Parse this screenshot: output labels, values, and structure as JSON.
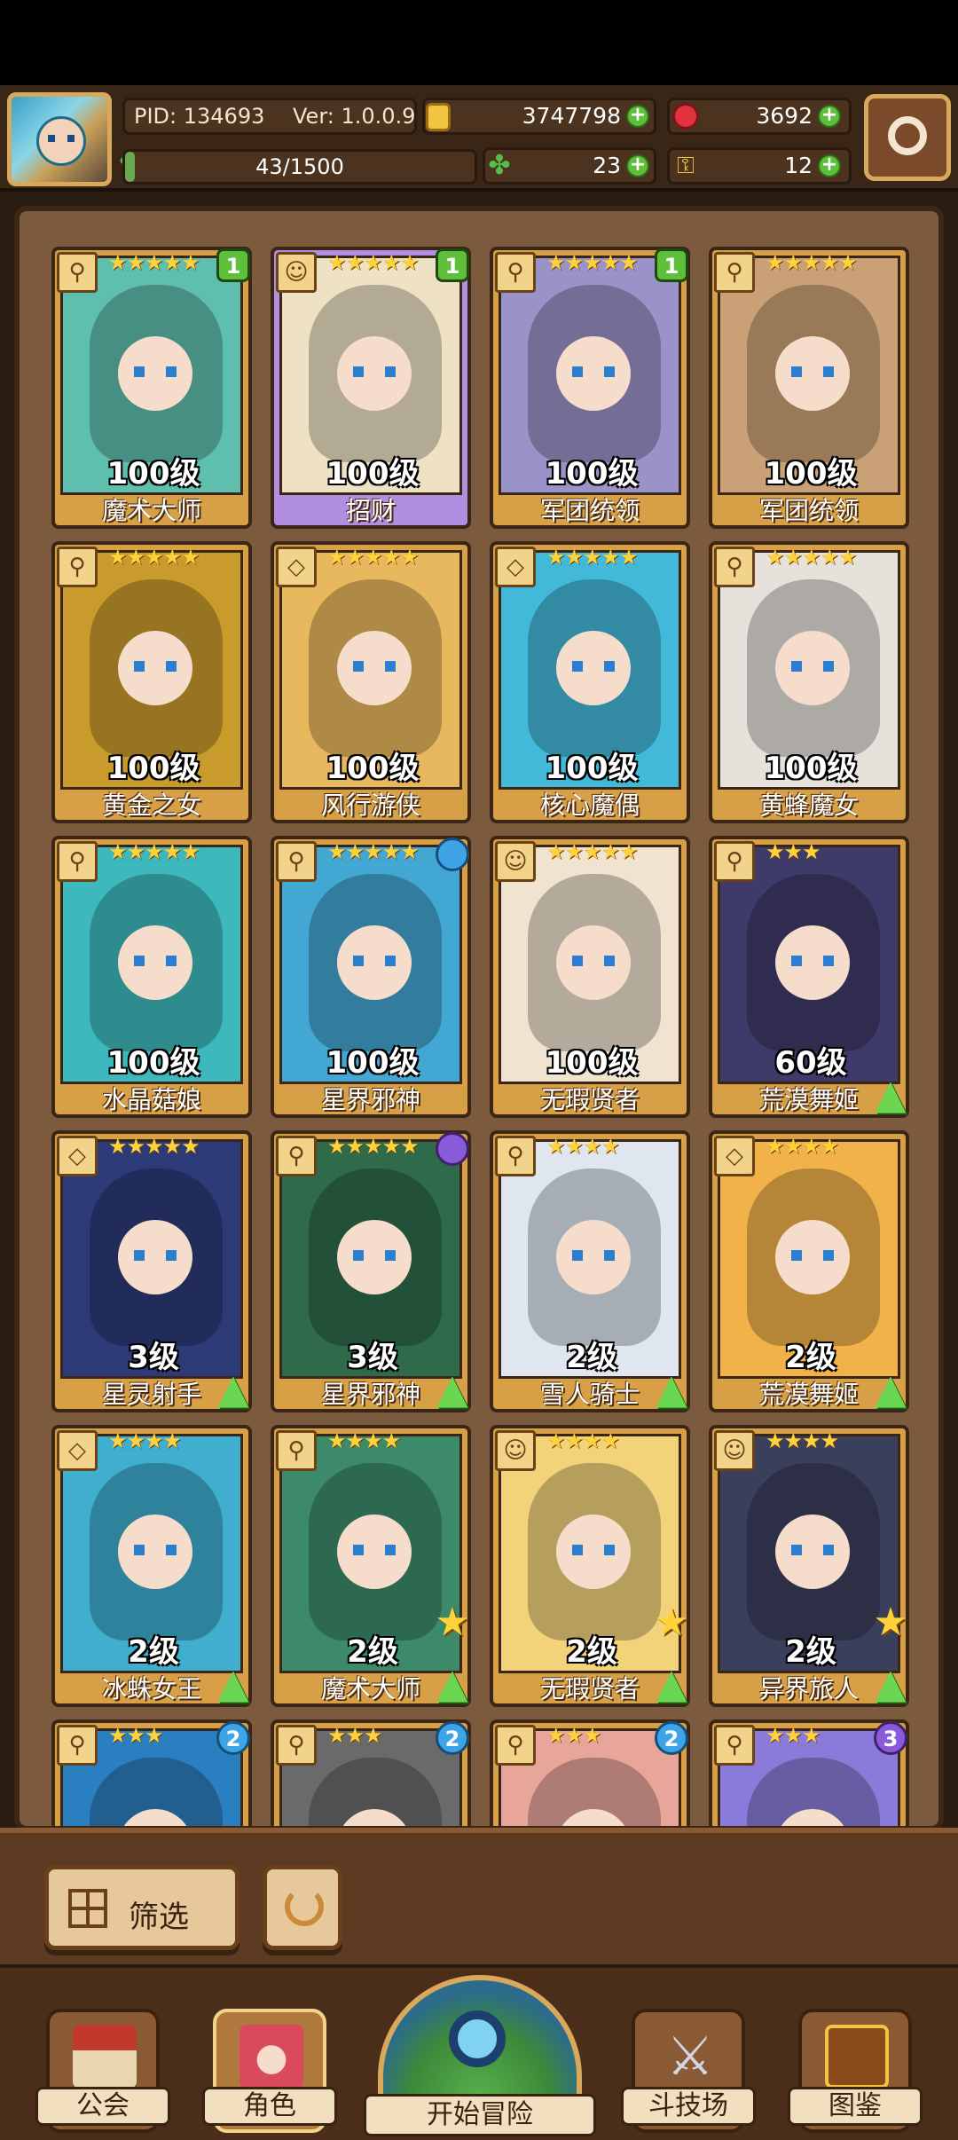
{
  "header": {
    "pid": "PID: 134693",
    "version": "Ver: 1.0.0.9",
    "gold": "3747798",
    "gems": "3692",
    "exp": "43/1500",
    "exp_fraction": 0.029,
    "clover": "23",
    "keys": "12",
    "icons": {
      "avatar": "player-avatar",
      "gold": "gold-coin-icon",
      "gems": "red-gem-icon",
      "clover": "clover-icon",
      "keys": "key-icon",
      "settings": "gear-icon"
    }
  },
  "cards": [
    {
      "level": "100级",
      "name": "魔术大师",
      "stars": "★★★★★",
      "badge": "1",
      "badge_type": "green",
      "frame": "gold",
      "art": "#5fbfae",
      "extra": ""
    },
    {
      "level": "100级",
      "name": "招财",
      "stars": "★★★★★",
      "badge": "1",
      "badge_type": "green",
      "frame": "purple",
      "art": "#efe2c4",
      "extra": ""
    },
    {
      "level": "100级",
      "name": "军团统领",
      "stars": "★★★★★",
      "badge": "1",
      "badge_type": "green",
      "frame": "gold",
      "art": "#9a93c9",
      "extra": ""
    },
    {
      "level": "100级",
      "name": "军团统领",
      "stars": "★★★★★",
      "badge": "",
      "badge_type": "",
      "frame": "gold",
      "art": "#caa176",
      "extra": ""
    },
    {
      "level": "100级",
      "name": "黄金之女",
      "stars": "★★★★★",
      "badge": "",
      "badge_type": "",
      "frame": "gold",
      "art": "#c99a2c",
      "extra": ""
    },
    {
      "level": "100级",
      "name": "风行游侠",
      "stars": "★★★★★",
      "badge": "",
      "badge_type": "",
      "frame": "gold",
      "art": "#e8b85e",
      "extra": ""
    },
    {
      "level": "100级",
      "name": "核心魔偶",
      "stars": "★★★★★",
      "badge": "",
      "badge_type": "",
      "frame": "gold",
      "art": "#42b9d9",
      "extra": ""
    },
    {
      "level": "100级",
      "name": "黄蜂魔女",
      "stars": "★★★★★",
      "badge": "",
      "badge_type": "",
      "frame": "gold",
      "art": "#e6e1da",
      "extra": ""
    },
    {
      "level": "100级",
      "name": "水晶菇娘",
      "stars": "★★★★★",
      "badge": "",
      "badge_type": "",
      "frame": "gold",
      "art": "#3db9bd",
      "extra": ""
    },
    {
      "level": "100级",
      "name": "星界邪神",
      "stars": "★★★★★",
      "badge": "",
      "badge_type": "blue",
      "frame": "gold",
      "art": "#42a7d2",
      "extra": ""
    },
    {
      "level": "100级",
      "name": "无瑕贤者",
      "stars": "★★★★★",
      "badge": "",
      "badge_type": "",
      "frame": "gold",
      "art": "#f0e3cf",
      "extra": ""
    },
    {
      "level": "60级",
      "name": "荒漠舞姬",
      "stars": "★★★",
      "badge": "",
      "badge_type": "",
      "frame": "gold",
      "art": "#3e3a6a",
      "extra": "up"
    },
    {
      "level": "3级",
      "name": "星灵射手",
      "stars": "★★★★★",
      "badge": "",
      "badge_type": "",
      "frame": "gold",
      "art": "#2d3a78",
      "extra": "up"
    },
    {
      "level": "3级",
      "name": "星界邪神",
      "stars": "★★★★★",
      "badge": "",
      "badge_type": "purple",
      "frame": "gold",
      "art": "#2f6a4a",
      "extra": "up"
    },
    {
      "level": "2级",
      "name": "雪人骑士",
      "stars": "★★★★",
      "badge": "",
      "badge_type": "",
      "frame": "gold",
      "art": "#dfe6f0",
      "extra": "up"
    },
    {
      "level": "2级",
      "name": "荒漠舞姬",
      "stars": "★★★★",
      "badge": "",
      "badge_type": "",
      "frame": "gold",
      "art": "#f2b24a",
      "extra": "up"
    },
    {
      "level": "2级",
      "name": "冰蛛女王",
      "stars": "★★★★",
      "badge": "",
      "badge_type": "",
      "frame": "gold",
      "art": "#3faecf",
      "extra": "up"
    },
    {
      "level": "2级",
      "name": "魔术大师",
      "stars": "★★★★",
      "badge": "",
      "badge_type": "",
      "frame": "gold",
      "art": "#3c8a6a",
      "extra": "star-up"
    },
    {
      "level": "2级",
      "name": "无瑕贤者",
      "stars": "★★★★",
      "badge": "",
      "badge_type": "",
      "frame": "gold",
      "art": "#f2d37a",
      "extra": "star-up"
    },
    {
      "level": "2级",
      "name": "异界旅人",
      "stars": "★★★★",
      "badge": "",
      "badge_type": "",
      "frame": "gold",
      "art": "#3a3f5c",
      "extra": "star-up"
    },
    {
      "level": "",
      "name": "",
      "stars": "★★★",
      "badge": "2",
      "badge_type": "blue",
      "frame": "gold",
      "art": "#2a7fc0",
      "extra": ""
    },
    {
      "level": "",
      "name": "",
      "stars": "★★★",
      "badge": "2",
      "badge_type": "blue",
      "frame": "gold",
      "art": "#6a6a6a",
      "extra": ""
    },
    {
      "level": "",
      "name": "",
      "stars": "★★★",
      "badge": "2",
      "badge_type": "blue",
      "frame": "gold",
      "art": "#e8a69a",
      "extra": ""
    },
    {
      "level": "",
      "name": "",
      "stars": "★★★",
      "badge": "3",
      "badge_type": "purple",
      "frame": "gold",
      "art": "#8a7ad9",
      "extra": ""
    }
  ],
  "toolbar": {
    "filter_label": "筛选",
    "filter_icon": "grid-filter-icon",
    "reset_icon": "refresh-icon"
  },
  "nav": {
    "guild": "公会",
    "characters": "角色",
    "adventure": "开始冒险",
    "arena": "斗技场",
    "codex": "图鉴"
  }
}
